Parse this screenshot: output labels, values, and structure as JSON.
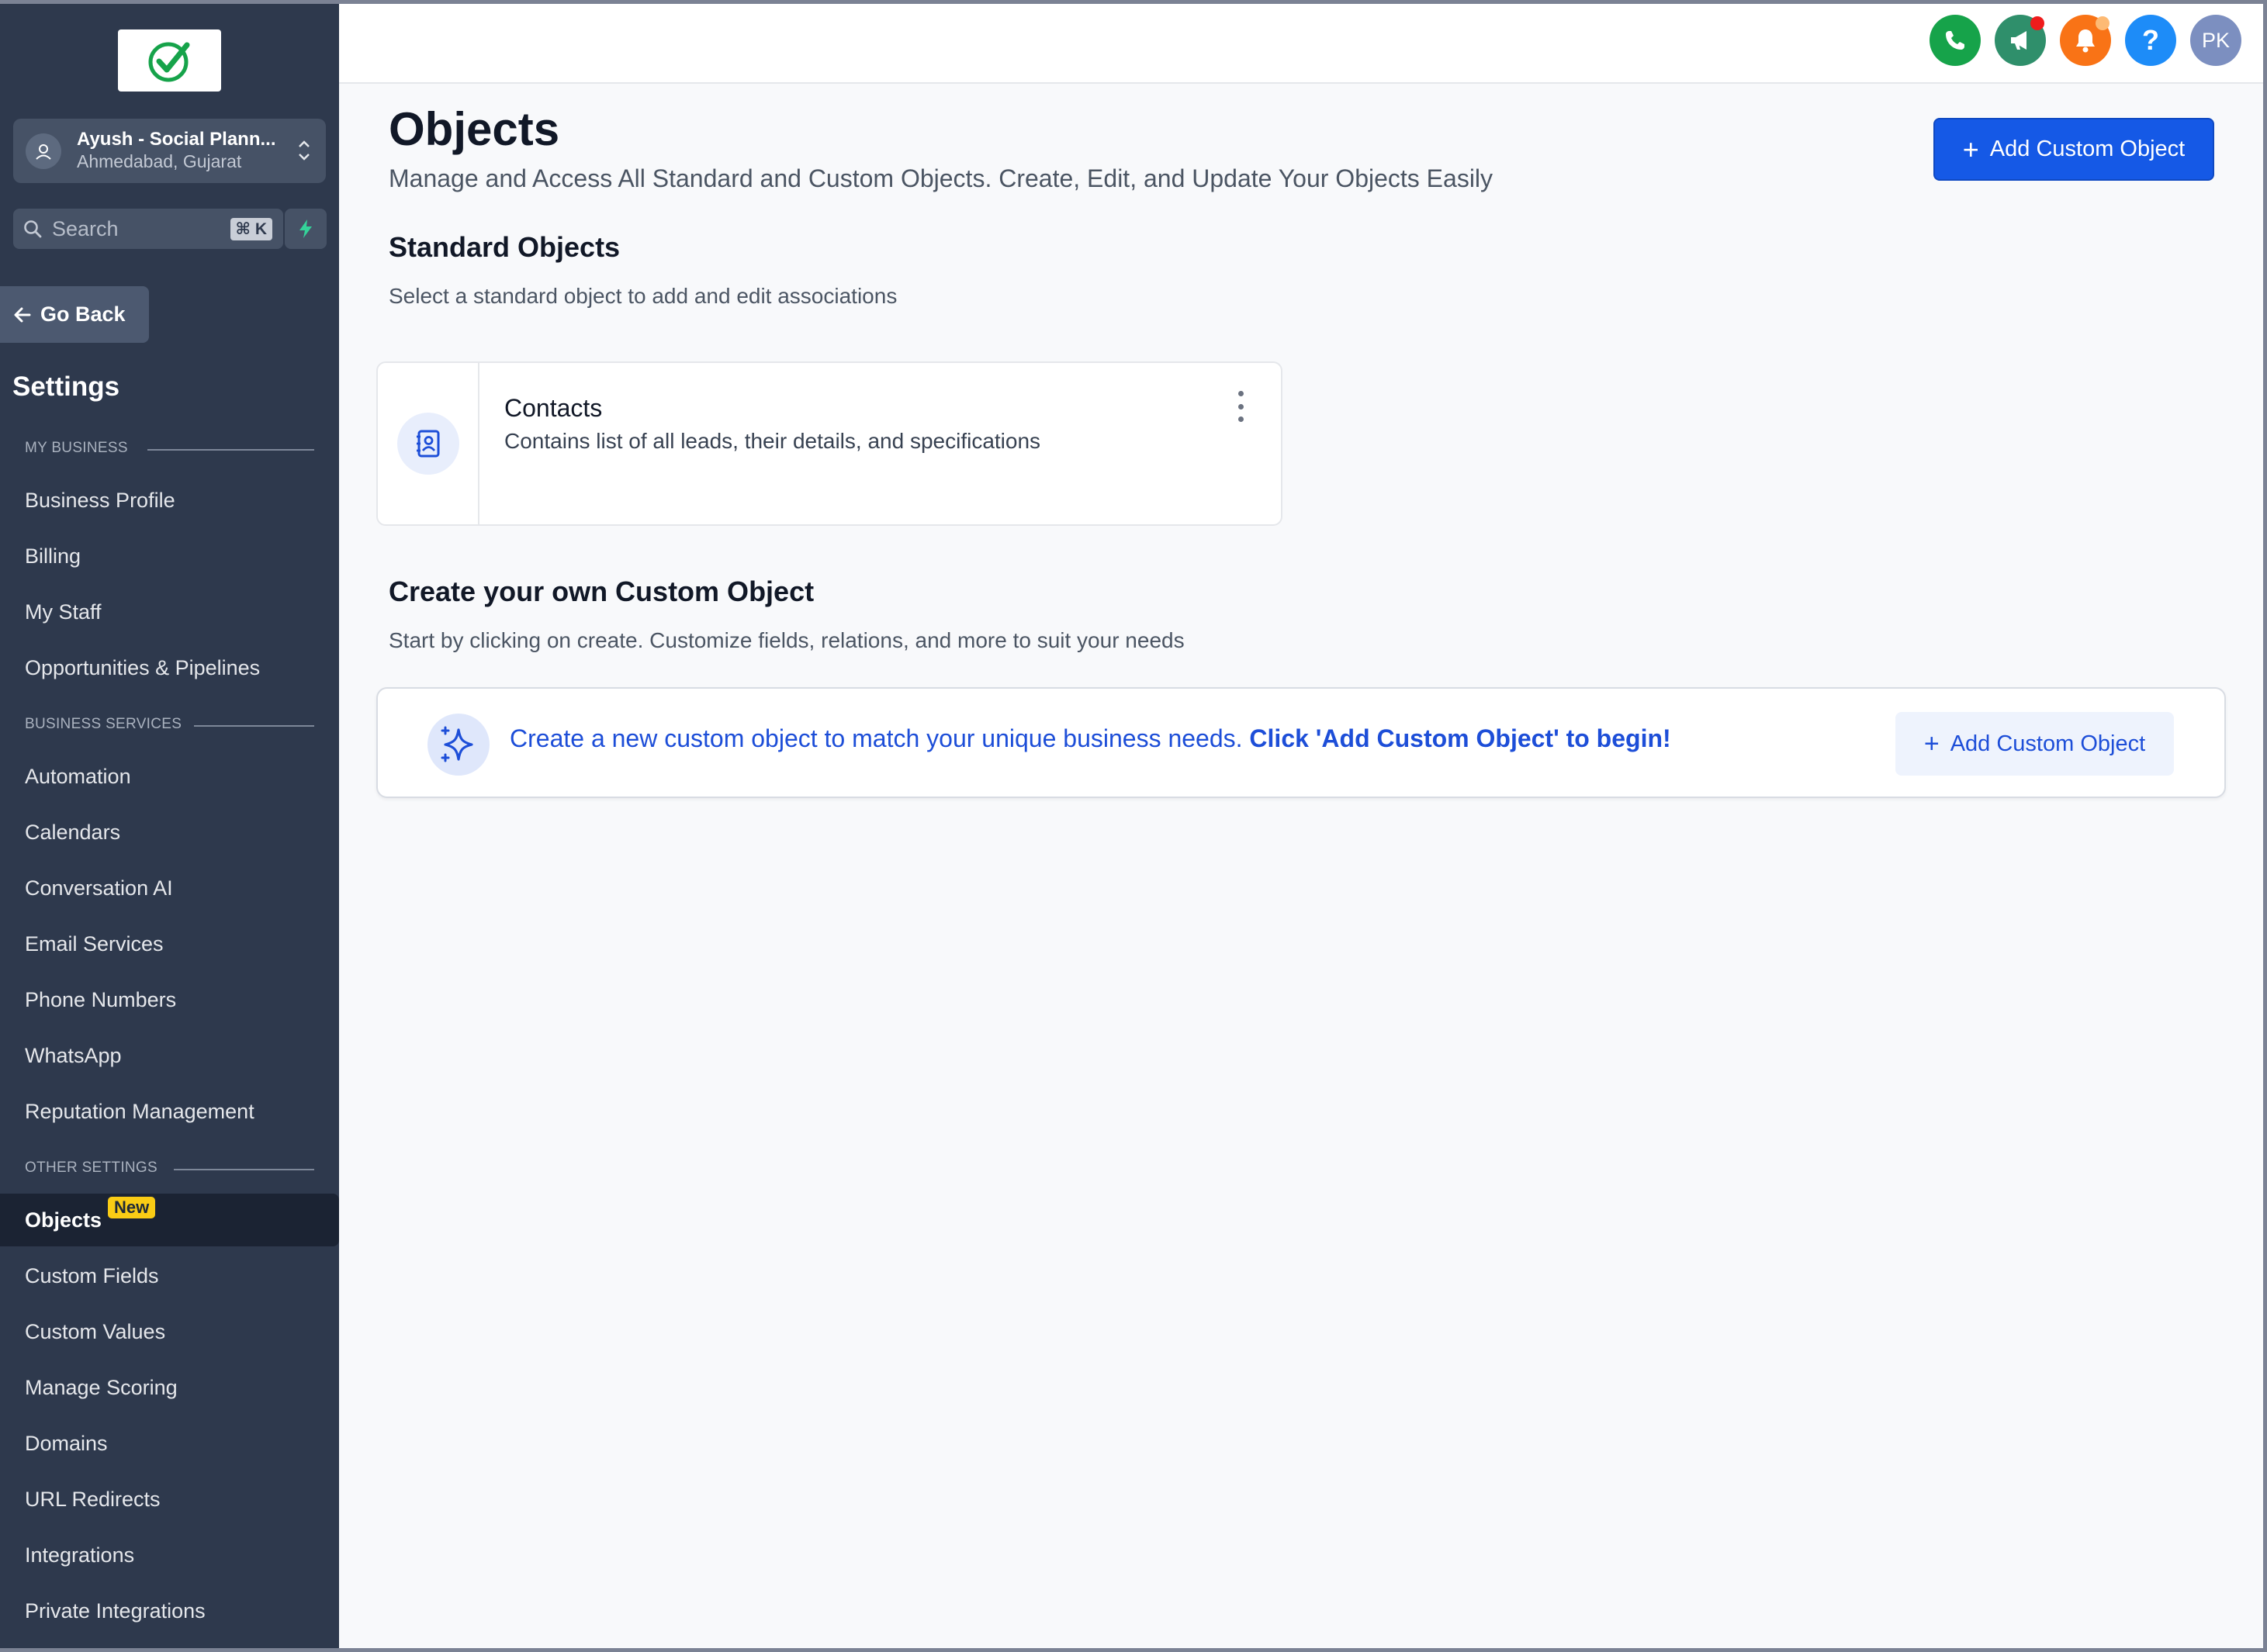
{
  "sidebar": {
    "account": {
      "name": "Ayush - Social Plann...",
      "location": "Ahmedabad, Gujarat"
    },
    "search": {
      "placeholder": "Search",
      "shortcut": "⌘ K"
    },
    "go_back": "Go Back",
    "title": "Settings",
    "groups": {
      "my_business": "MY BUSINESS",
      "business_services": "BUSINESS SERVICES",
      "other_settings": "OTHER SETTINGS"
    },
    "items": [
      "Business Profile",
      "Billing",
      "My Staff",
      "Opportunities & Pipelines",
      "Automation",
      "Calendars",
      "Conversation AI",
      "Email Services",
      "Phone Numbers",
      "WhatsApp",
      "Reputation Management",
      "Objects",
      "Custom Fields",
      "Custom Values",
      "Manage Scoring",
      "Domains",
      "URL Redirects",
      "Integrations",
      "Private Integrations"
    ],
    "active_badge": "New"
  },
  "header": {
    "avatar_initials": "PK",
    "icons": [
      "phone-icon",
      "megaphone-icon",
      "bell-icon",
      "help-icon",
      "user-avatar"
    ],
    "colors": {
      "phone": "#16a34a",
      "announcements": "#2f8f6b",
      "notifications": "#f97316",
      "help": "#1d8cf8",
      "avatar": "#7c8fc0"
    }
  },
  "main": {
    "title": "Objects",
    "subtitle": "Manage and Access All Standard and Custom Objects. Create, Edit, and Update Your Objects Easily",
    "add_button": "Add Custom Object",
    "standard": {
      "title": "Standard Objects",
      "description": "Select a standard object to add and edit associations",
      "cards": [
        {
          "name": "Contacts",
          "description": "Contains list of all leads, their details, and specifications",
          "icon": "contact-book-icon"
        }
      ]
    },
    "custom": {
      "title": "Create your own Custom Object",
      "description": "Start by clicking on create. Customize fields, relations, and more to suit your needs",
      "banner_text": "Create a new custom object to match your unique business needs.",
      "banner_strong": "Click 'Add Custom Object' to begin!",
      "banner_button": "Add Custom Object",
      "banner_icon": "sparkle-icon"
    }
  },
  "colors": {
    "accent": "#1559e6",
    "sidebar_bg": "#2e394d",
    "badge": "#facc15"
  }
}
